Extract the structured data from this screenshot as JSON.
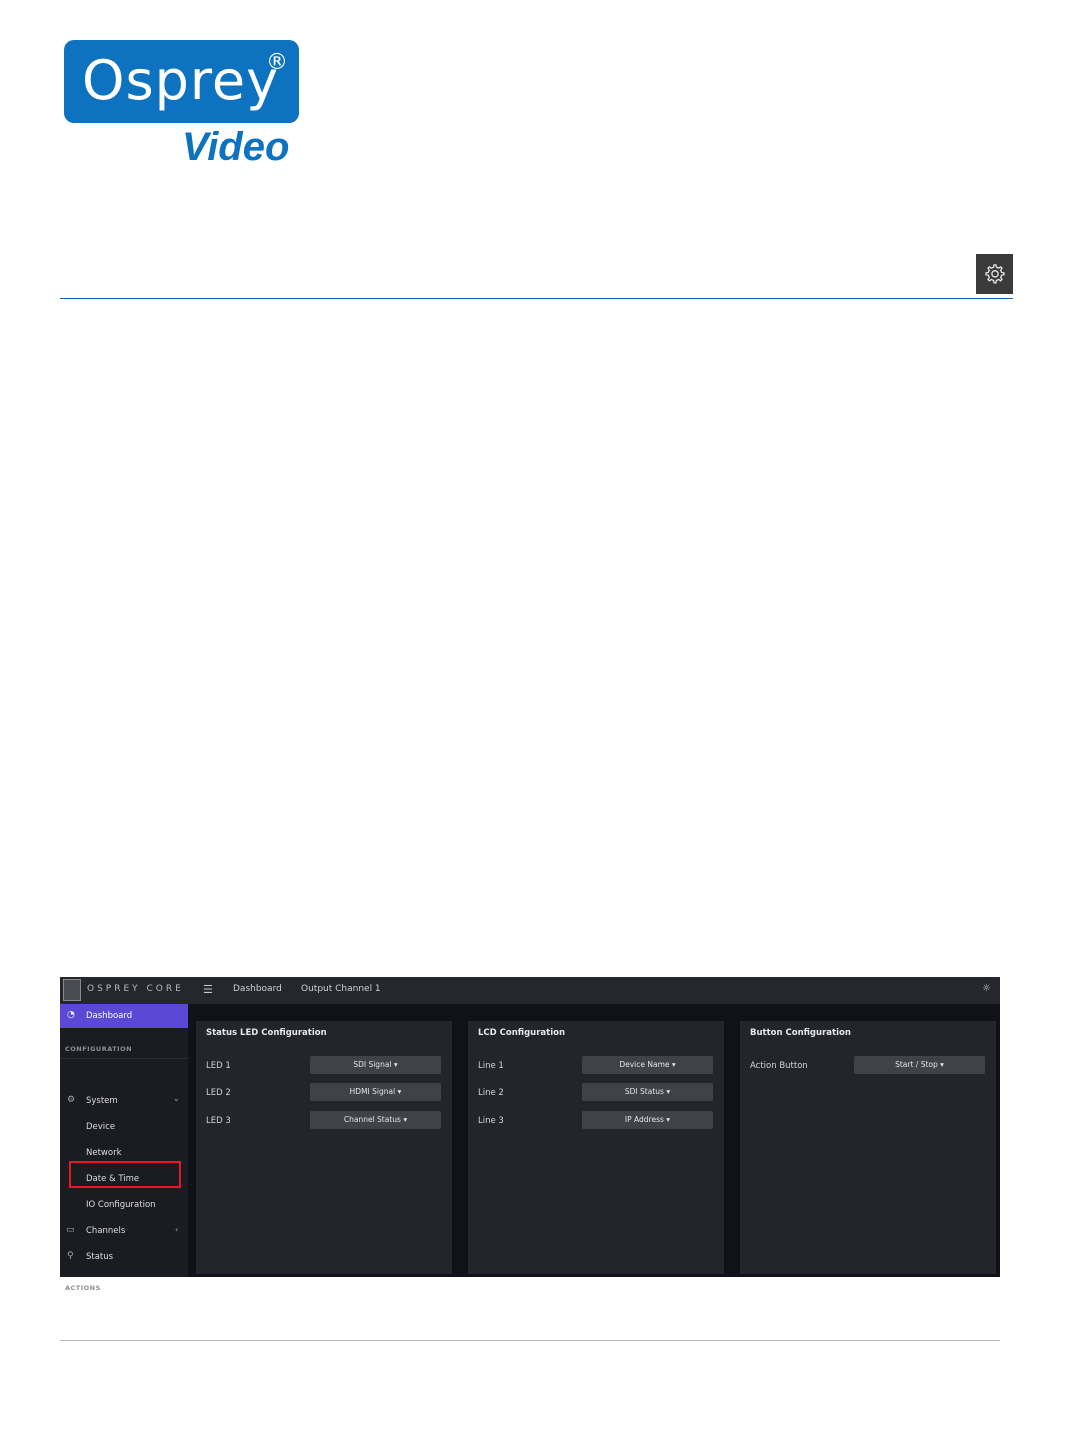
{
  "logo": {
    "word": "Osprey",
    "registered": "®",
    "sub": "Video"
  },
  "shot": {
    "brand": "OSPREY CORE",
    "breadcrumbs": [
      "Dashboard",
      "Output Channel 1"
    ],
    "sidebar": {
      "dashboard": "Dashboard",
      "section_configuration": "CONFIGURATION",
      "system": "System",
      "device": "Device",
      "network": "Network",
      "date_time": "Date & Time",
      "io_configuration": "IO Configuration",
      "channels": "Channels",
      "status": "Status",
      "section_actions": "ACTIONS"
    },
    "panels": [
      {
        "title": "Status LED Configuration",
        "rows": [
          {
            "label": "LED 1",
            "value": "SDI Signal ▾"
          },
          {
            "label": "LED 2",
            "value": "HDMI Signal ▾"
          },
          {
            "label": "LED 3",
            "value": "Channel Status ▾"
          }
        ]
      },
      {
        "title": "LCD Configuration",
        "rows": [
          {
            "label": "Line 1",
            "value": "Device Name ▾"
          },
          {
            "label": "Line 2",
            "value": "SDI Status ▾"
          },
          {
            "label": "Line 3",
            "value": "IP Address ▾"
          }
        ]
      },
      {
        "title": "Button Configuration",
        "rows": [
          {
            "label": "Action Button",
            "value": "Start / Stop ▾"
          }
        ]
      }
    ]
  }
}
